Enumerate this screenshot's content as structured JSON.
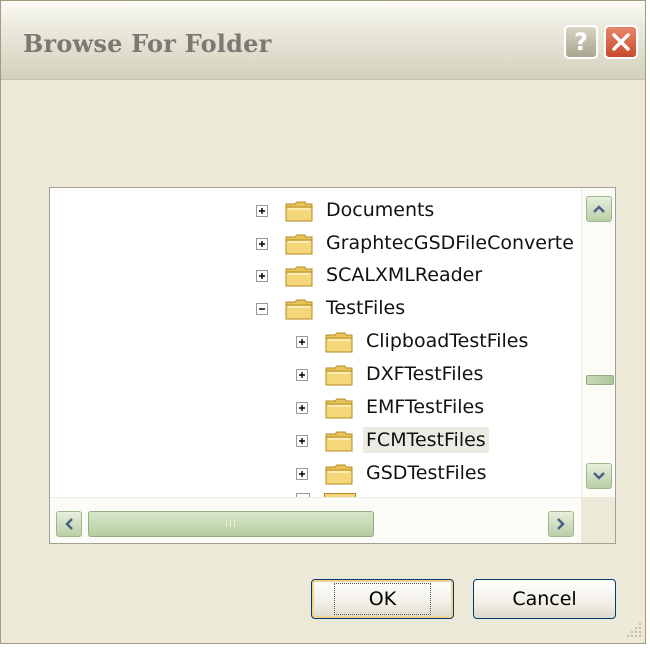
{
  "window": {
    "title": "Browse For Folder",
    "help_glyph": "?",
    "help_icon": "question-mark-icon",
    "close_icon": "close-x-icon"
  },
  "tree": {
    "items": [
      {
        "label": "Documents",
        "expander": "plus",
        "selected": false
      },
      {
        "label": "GraphtecGSDFileConverte",
        "expander": "plus",
        "selected": false
      },
      {
        "label": "SCALXMLReader",
        "expander": "plus",
        "selected": false
      },
      {
        "label": "TestFiles",
        "expander": "minus",
        "selected": false
      },
      {
        "label": "ClipboadTestFiles",
        "expander": "plus",
        "selected": false
      },
      {
        "label": "DXFTestFiles",
        "expander": "plus",
        "selected": false
      },
      {
        "label": "EMFTestFiles",
        "expander": "plus",
        "selected": false
      },
      {
        "label": "FCMTestFiles",
        "expander": "plus",
        "selected": true
      },
      {
        "label": "GSDTestFiles",
        "expander": "plus",
        "selected": false
      }
    ],
    "grip_glyph": "III"
  },
  "buttons": {
    "ok": "OK",
    "cancel": "Cancel"
  },
  "colors": {
    "dialog_bg": "#ece9d8",
    "folder_fill": "#f5d77b",
    "scroll_accent": "#b9cfa6",
    "close_red": "#c84b2a"
  }
}
